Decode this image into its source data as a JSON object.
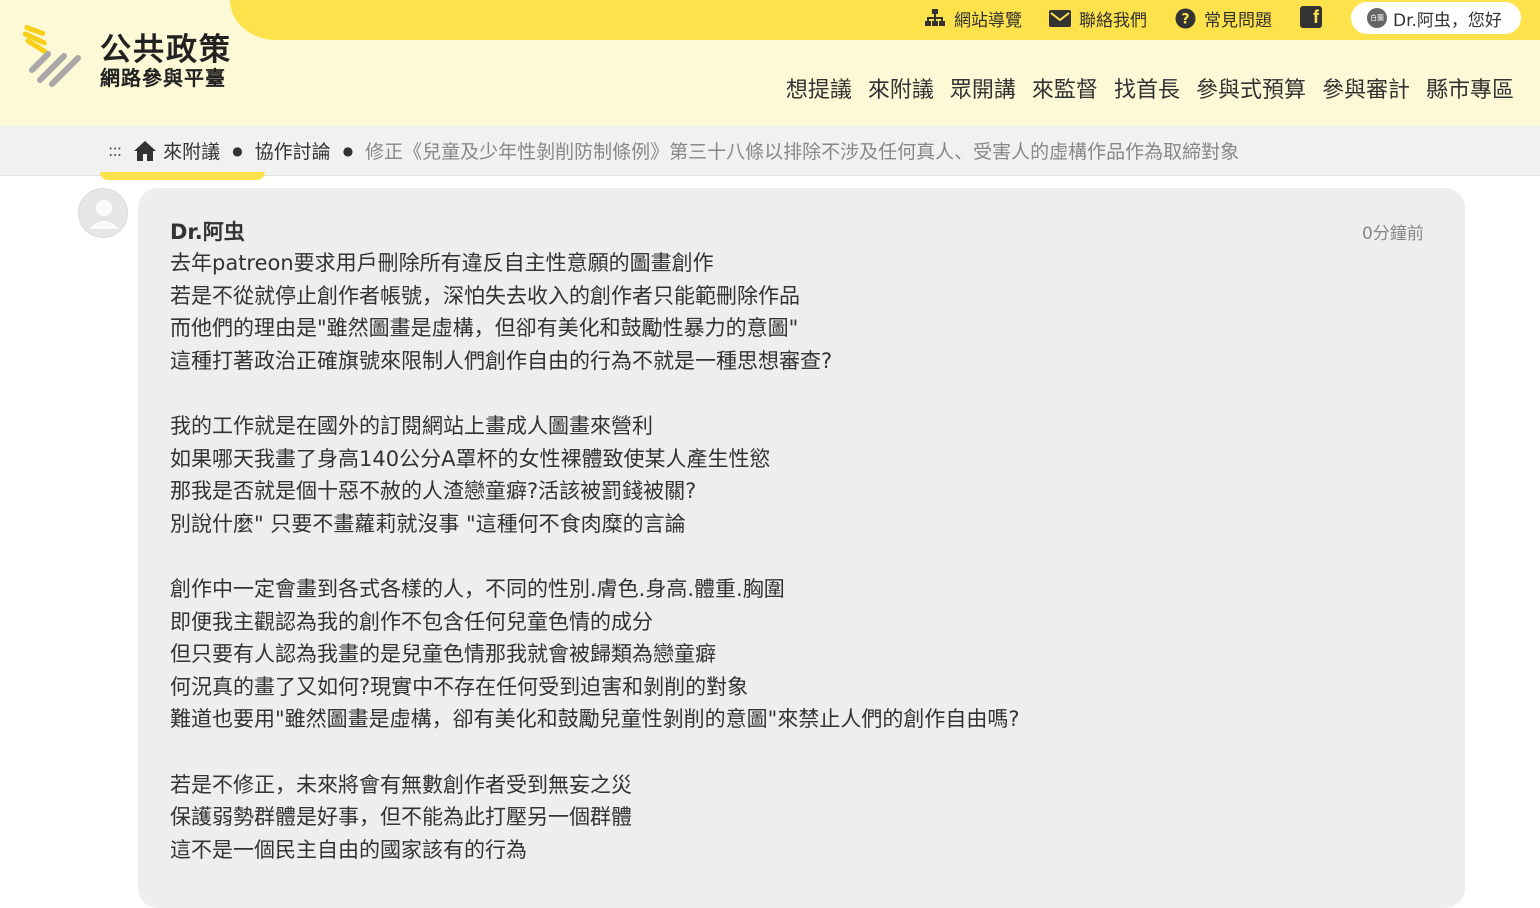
{
  "header": {
    "logo_title": "公共政策",
    "logo_sub": "網路參與平臺",
    "top_links": {
      "sitemap": "網站導覽",
      "contact": "聯絡我們",
      "faq": "常見問題"
    },
    "user": {
      "badge": "白蘭",
      "greeting": "Dr.阿虫，您好"
    },
    "nav": [
      "想提議",
      "來附議",
      "眾開講",
      "來監督",
      "找首長",
      "參與式預算",
      "參與審計",
      "縣市專區"
    ]
  },
  "breadcrumb": {
    "dots": ":::",
    "items": [
      "來附議",
      "協作討論"
    ],
    "separator": "●",
    "current": "修正《兒童及少年性剝削防制條例》第三十八條以排除不涉及任何真人、受害人的虛構作品作為取締對象"
  },
  "comment": {
    "author": "Dr.阿虫",
    "time": "0分鐘前",
    "lines": [
      "去年patreon要求用戶刪除所有違反自主性意願的圖畫創作",
      "若是不從就停止創作者帳號，深怕失去收入的創作者只能範刪除作品",
      "而他們的理由是\"雖然圖畫是虛構，但卻有美化和鼓勵性暴力的意圖\"",
      "這種打著政治正確旗號來限制人們創作自由的行為不就是一種思想審查?",
      "",
      "我的工作就是在國外的訂閱網站上畫成人圖畫來營利",
      "如果哪天我畫了身高140公分A罩杯的女性裸體致使某人產生性慾",
      "那我是否就是個十惡不赦的人渣戀童癖?活該被罰錢被關?",
      "別說什麼\" 只要不畫蘿莉就沒事 \"這種何不食肉糜的言論",
      "",
      "創作中一定會畫到各式各樣的人，不同的性別.膚色.身高.體重.胸圍",
      "即便我主觀認為我的創作不包含任何兒童色情的成分",
      "但只要有人認為我畫的是兒童色情那我就會被歸類為戀童癖",
      "何況真的畫了又如何?現實中不存在任何受到迫害和剝削的對象",
      "難道也要用\"雖然圖畫是虛構，卻有美化和鼓勵兒童性剝削的意圖\"來禁止人們的創作自由嗎?",
      "",
      "若是不修正，未來將會有無數創作者受到無妄之災",
      "保護弱勢群體是好事，但不能為此打壓另一個群體",
      "這不是一個民主自由的國家該有的行為"
    ]
  },
  "colors": {
    "brand_yellow": "#fde24c",
    "header_bg": "#fdf8d6",
    "bubble_bg": "#eeeeee"
  },
  "icons": [
    "sitemap-icon",
    "mail-icon",
    "help-icon",
    "facebook-icon",
    "home-icon",
    "avatar-icon"
  ]
}
